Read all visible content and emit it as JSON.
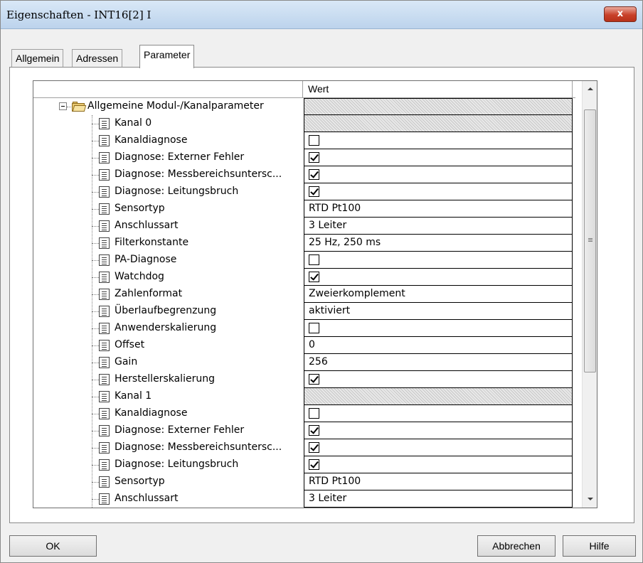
{
  "window": {
    "title": "Eigenschaften - INT16[2] I",
    "close_label": "x"
  },
  "tabs": [
    {
      "label": "Allgemein",
      "active": false
    },
    {
      "label": "Adressen",
      "active": false
    },
    {
      "label": "Parameter",
      "active": true
    }
  ],
  "grid": {
    "value_header": "Wert",
    "root_label": "Allgemeine Modul-/Kanalparameter",
    "rows": [
      {
        "label": "Kanal 0",
        "type": "hatched"
      },
      {
        "label": "Kanaldiagnose",
        "type": "checkbox",
        "checked": false
      },
      {
        "label": "Diagnose: Externer Fehler",
        "type": "checkbox",
        "checked": true
      },
      {
        "label": "Diagnose: Messbereichsuntersc...",
        "type": "checkbox",
        "checked": true
      },
      {
        "label": "Diagnose: Leitungsbruch",
        "type": "checkbox",
        "checked": true
      },
      {
        "label": "Sensortyp",
        "type": "text",
        "value": "RTD Pt100"
      },
      {
        "label": "Anschlussart",
        "type": "text",
        "value": "3 Leiter"
      },
      {
        "label": "Filterkonstante",
        "type": "text",
        "value": "25 Hz, 250 ms"
      },
      {
        "label": "PA-Diagnose",
        "type": "checkbox",
        "checked": false
      },
      {
        "label": "Watchdog",
        "type": "checkbox",
        "checked": true
      },
      {
        "label": "Zahlenformat",
        "type": "text",
        "value": "Zweierkomplement"
      },
      {
        "label": "Überlaufbegrenzung",
        "type": "text",
        "value": "aktiviert"
      },
      {
        "label": "Anwenderskalierung",
        "type": "checkbox",
        "checked": false
      },
      {
        "label": "Offset",
        "type": "text",
        "value": "0"
      },
      {
        "label": "Gain",
        "type": "text",
        "value": "256"
      },
      {
        "label": "Herstellerskalierung",
        "type": "checkbox",
        "checked": true
      },
      {
        "label": "Kanal 1",
        "type": "hatched"
      },
      {
        "label": "Kanaldiagnose",
        "type": "checkbox",
        "checked": false
      },
      {
        "label": "Diagnose: Externer Fehler",
        "type": "checkbox",
        "checked": true
      },
      {
        "label": "Diagnose: Messbereichsuntersc...",
        "type": "checkbox",
        "checked": true
      },
      {
        "label": "Diagnose: Leitungsbruch",
        "type": "checkbox",
        "checked": true
      },
      {
        "label": "Sensortyp",
        "type": "text",
        "value": "RTD Pt100"
      },
      {
        "label": "Anschlussart",
        "type": "text",
        "value": "3 Leiter"
      }
    ]
  },
  "buttons": {
    "ok": "OK",
    "cancel": "Abbrechen",
    "help": "Hilfe"
  }
}
